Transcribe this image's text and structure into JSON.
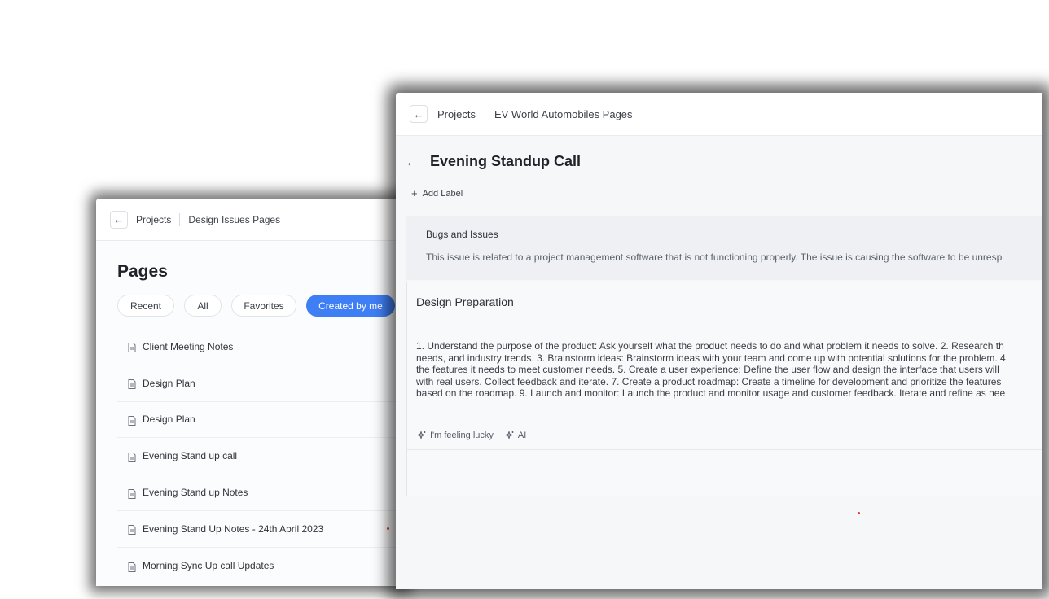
{
  "back_window": {
    "breadcrumb": {
      "root": "Projects",
      "current": "Design Issues Pages"
    },
    "title": "Pages",
    "filters": [
      {
        "label": "Recent",
        "active": false
      },
      {
        "label": "All",
        "active": false
      },
      {
        "label": "Favorites",
        "active": false
      },
      {
        "label": "Created by me",
        "active": true
      }
    ],
    "pages": [
      "Client Meeting Notes",
      "Design Plan",
      "Design Plan",
      "Evening Stand up call",
      "Evening Stand up Notes",
      "Evening Stand Up Notes - 24th April 2023",
      "Morning Sync Up call Updates"
    ]
  },
  "front_window": {
    "breadcrumb": {
      "root": "Projects",
      "current": "EV World Automobiles Pages"
    },
    "title": "Evening Standup Call",
    "add_label": "Add Label",
    "issue": {
      "title": "Bugs and Issues",
      "description": "This issue is related to a project management software that is not functioning properly. The issue is causing the software to be unresp"
    },
    "card": {
      "title": "Design Preparation",
      "body_lines": [
        "1. Understand the purpose of the product: Ask yourself what the product needs to do and what problem it needs to solve. 2. Research th",
        "needs, and industry trends. 3. Brainstorm ideas: Brainstorm ideas with your team and come up with potential solutions for the problem. 4",
        "the features it needs to meet customer needs. 5. Create a user experience: Define the user flow and design the interface that users will",
        "with real users. Collect feedback and iterate. 7. Create a product roadmap: Create a timeline for development and prioritize the features",
        "based on the roadmap. 9. Launch and monitor: Launch the product and monitor usage and customer feedback. Iterate and refine as nee"
      ],
      "actions": [
        "I'm feeling lucky",
        "AI"
      ]
    }
  },
  "colors": {
    "accent": "#3f7ff5",
    "dot": "#e03a2e"
  },
  "icons": {
    "back": "arrow-left-icon",
    "page": "document-icon",
    "add": "plus-icon",
    "ai": "sparkle-icon"
  }
}
